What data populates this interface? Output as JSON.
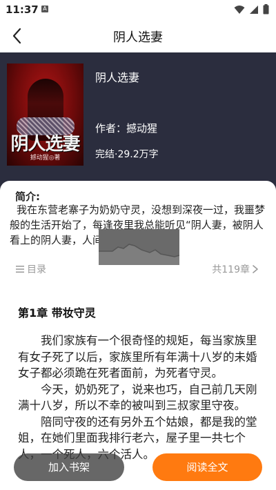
{
  "status_bar": {
    "time": "11:37",
    "badge": "A"
  },
  "nav": {
    "title": "阴人选妻"
  },
  "book": {
    "cover_title": "阴人选妻",
    "cover_author": "撼动猩◎著",
    "name": "阴人选妻",
    "author": "作者：撼动猩",
    "status": "完结·29.2万字"
  },
  "intro": {
    "label": "简介:",
    "text": "我在东营老寨子为奶奶守灵，没想到深夜一过，我噩梦般的生活开始了，每逢夜里我总能听见“阴人妻，被阴人看上的阴人妻，人间..."
  },
  "toc": {
    "label": "目录",
    "count": "共119章"
  },
  "chapter": {
    "title": "第1章 带妆守灵",
    "paragraphs": [
      "我们家族有一个很奇怪的规矩，每当家族里有女子死了以后，家族里所有年满十八岁的未婚女子都必须跪在死者面前，为死者守灵。",
      "今天，奶奶死了，说来也巧，自己前几天刚满十八岁，所以不幸的被叫到三叔家里守夜。",
      "陪同守夜的还有另外五个姑娘，都是我的堂姐，在她们里面我排行老六，屋子里一共七个人，一个死人，六个活人。"
    ]
  },
  "buttons": {
    "shelf": "加入书架",
    "read": "阅读全文"
  },
  "colors": {
    "accent": "#ff7a10",
    "header_bg": "#2b2d3e"
  }
}
